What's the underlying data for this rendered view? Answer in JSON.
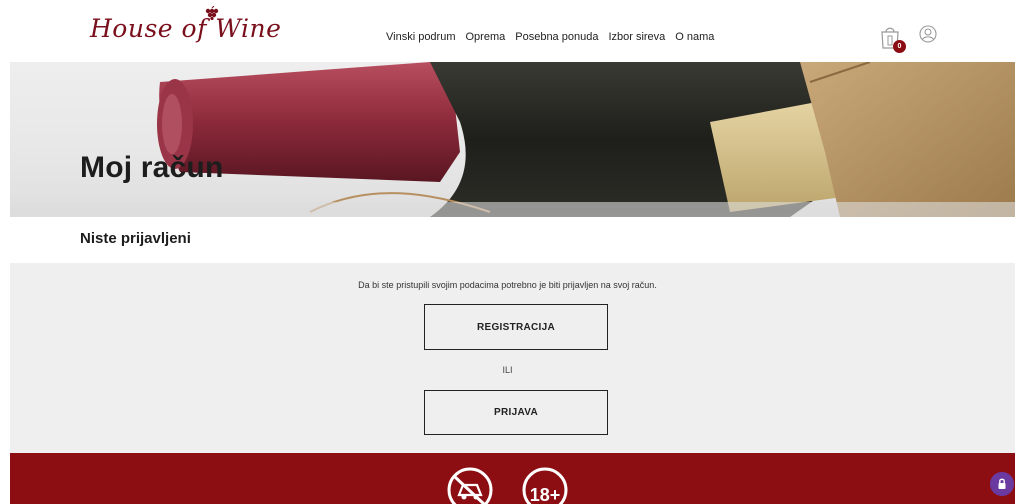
{
  "header": {
    "logo": "House of Wine",
    "nav": [
      "Vinski podrum",
      "Oprema",
      "Posebna ponuda",
      "Izbor sireva",
      "O nama"
    ],
    "cart_count": "0",
    "colors": {
      "brand": "#7a0f1c",
      "badge": "#8b0d13"
    },
    "icons": [
      "grape-icon",
      "shopping-bag-icon",
      "user-icon"
    ]
  },
  "hero": {
    "title": "Moj račun"
  },
  "subheading": "Niste prijavljeni",
  "panel": {
    "notice": "Da bi ste pristupili svojim podacima potrebno je biti prijavljen na svoj račun.",
    "register_label": "REGISTRACIJA",
    "or_label": "ILI",
    "login_label": "PRIJAVA"
  },
  "footer": {
    "background": "#8c0e12",
    "age_label": "18+",
    "icons": [
      "no-drink-driving-icon",
      "age-18-icon",
      "lock-icon"
    ]
  }
}
